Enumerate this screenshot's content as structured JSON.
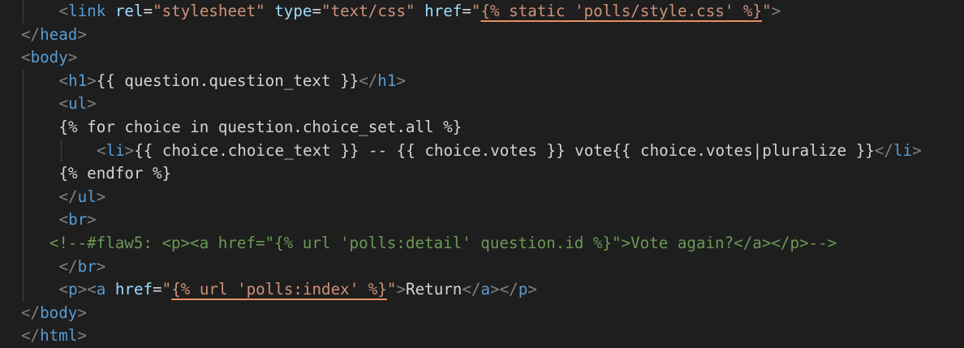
{
  "editor": {
    "language": "html-django-template",
    "lines": [
      {
        "indent": 1,
        "segments": [
          {
            "t": "<",
            "c": "tagp"
          },
          {
            "t": "link",
            "c": "tag"
          },
          {
            "t": " ",
            "c": "txt"
          },
          {
            "t": "rel",
            "c": "attr"
          },
          {
            "t": "=",
            "c": "txt"
          },
          {
            "t": "\"stylesheet\"",
            "c": "str"
          },
          {
            "t": " ",
            "c": "txt"
          },
          {
            "t": "type",
            "c": "attr"
          },
          {
            "t": "=",
            "c": "txt"
          },
          {
            "t": "\"text/css\"",
            "c": "str"
          },
          {
            "t": " ",
            "c": "txt"
          },
          {
            "t": "href",
            "c": "attr"
          },
          {
            "t": "=",
            "c": "txt"
          },
          {
            "t": "\"",
            "c": "str"
          },
          {
            "t": "{% static 'polls/style.css' %}",
            "c": "str",
            "warn": true
          },
          {
            "t": "\"",
            "c": "str"
          },
          {
            "t": ">",
            "c": "tagp"
          }
        ]
      },
      {
        "indent": 0,
        "segments": [
          {
            "t": "</",
            "c": "tagp"
          },
          {
            "t": "head",
            "c": "tag"
          },
          {
            "t": ">",
            "c": "tagp"
          }
        ]
      },
      {
        "indent": 0,
        "segments": [
          {
            "t": "<",
            "c": "tagp"
          },
          {
            "t": "body",
            "c": "tag"
          },
          {
            "t": ">",
            "c": "tagp"
          }
        ]
      },
      {
        "indent": 1,
        "segments": [
          {
            "t": "<",
            "c": "tagp"
          },
          {
            "t": "h1",
            "c": "tag"
          },
          {
            "t": ">",
            "c": "tagp"
          },
          {
            "t": "{{ question.question_text }}",
            "c": "txt"
          },
          {
            "t": "</",
            "c": "tagp"
          },
          {
            "t": "h1",
            "c": "tag"
          },
          {
            "t": ">",
            "c": "tagp"
          }
        ]
      },
      {
        "indent": 1,
        "segments": [
          {
            "t": "<",
            "c": "tagp"
          },
          {
            "t": "ul",
            "c": "tag"
          },
          {
            "t": ">",
            "c": "tagp"
          }
        ]
      },
      {
        "indent": 1,
        "segments": [
          {
            "t": "{% for choice in question.choice_set.all %}",
            "c": "txt"
          }
        ]
      },
      {
        "indent": 2,
        "segments": [
          {
            "t": "<",
            "c": "tagp"
          },
          {
            "t": "li",
            "c": "tag"
          },
          {
            "t": ">",
            "c": "tagp"
          },
          {
            "t": "{{ choice.choice_text }} -- {{ choice.votes }} vote{{ choice.votes",
            "c": "txt"
          },
          {
            "t": "|",
            "c": "txt",
            "cursor": true
          },
          {
            "t": "pluralize }}",
            "c": "txt"
          },
          {
            "t": "</",
            "c": "tagp"
          },
          {
            "t": "li",
            "c": "tag"
          },
          {
            "t": ">",
            "c": "tagp"
          }
        ]
      },
      {
        "indent": 1,
        "segments": [
          {
            "t": "{% endfor %}",
            "c": "txt"
          }
        ]
      },
      {
        "indent": 1,
        "segments": [
          {
            "t": "</",
            "c": "tagp"
          },
          {
            "t": "ul",
            "c": "tag"
          },
          {
            "t": ">",
            "c": "tagp"
          }
        ]
      },
      {
        "indent": 1,
        "segments": [
          {
            "t": "<",
            "c": "tagp"
          },
          {
            "t": "br",
            "c": "tag"
          },
          {
            "t": ">",
            "c": "tagp"
          }
        ]
      },
      {
        "indent": 0.75,
        "segments": [
          {
            "t": "<!--#flaw5: <p><a href=\"{% url 'polls:detail' question.id %}\">Vote again?</a></p>-->",
            "c": "cmt"
          }
        ]
      },
      {
        "indent": 1,
        "segments": [
          {
            "t": "</",
            "c": "tagp"
          },
          {
            "t": "br",
            "c": "tag"
          },
          {
            "t": ">",
            "c": "tagp"
          }
        ]
      },
      {
        "indent": 1,
        "segments": [
          {
            "t": "<",
            "c": "tagp"
          },
          {
            "t": "p",
            "c": "tag"
          },
          {
            "t": ">",
            "c": "tagp"
          },
          {
            "t": "<",
            "c": "tagp"
          },
          {
            "t": "a",
            "c": "tag"
          },
          {
            "t": " ",
            "c": "txt"
          },
          {
            "t": "href",
            "c": "attr"
          },
          {
            "t": "=",
            "c": "txt"
          },
          {
            "t": "\"",
            "c": "str"
          },
          {
            "t": "{% url 'polls:index' %}",
            "c": "str",
            "warn": true
          },
          {
            "t": "\"",
            "c": "str"
          },
          {
            "t": ">",
            "c": "tagp"
          },
          {
            "t": "Return",
            "c": "txt"
          },
          {
            "t": "</",
            "c": "tagp"
          },
          {
            "t": "a",
            "c": "tag"
          },
          {
            "t": ">",
            "c": "tagp"
          },
          {
            "t": "</",
            "c": "tagp"
          },
          {
            "t": "p",
            "c": "tag"
          },
          {
            "t": ">",
            "c": "tagp"
          }
        ]
      },
      {
        "indent": 0,
        "segments": [
          {
            "t": "</",
            "c": "tagp"
          },
          {
            "t": "body",
            "c": "tag"
          },
          {
            "t": ">",
            "c": "tagp"
          }
        ]
      },
      {
        "indent": 0,
        "segments": [
          {
            "t": "</",
            "c": "tagp"
          },
          {
            "t": "html",
            "c": "tag"
          },
          {
            "t": ">",
            "c": "tagp"
          }
        ]
      }
    ]
  }
}
